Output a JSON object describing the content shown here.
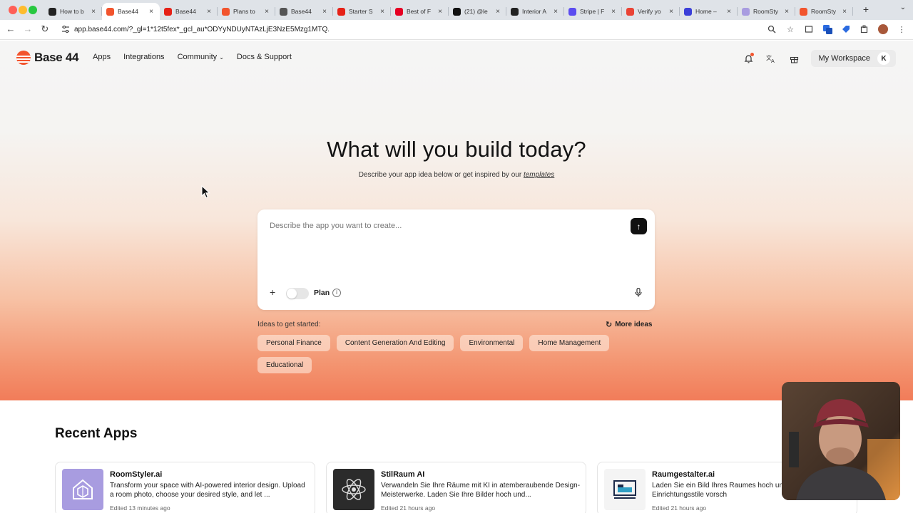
{
  "browser": {
    "tabs": [
      {
        "title": "How to b",
        "color": "#222222",
        "active": false
      },
      {
        "title": "Base44",
        "color": "#f2542d",
        "active": true
      },
      {
        "title": "Base44",
        "color": "#e62117",
        "active": false
      },
      {
        "title": "Plans to",
        "color": "#f2542d",
        "active": false
      },
      {
        "title": "Base44",
        "color": "#555555",
        "active": false
      },
      {
        "title": "Starter S",
        "color": "#e62117",
        "active": false
      },
      {
        "title": "Best of F",
        "color": "#e60023",
        "active": false
      },
      {
        "title": "(21) @le",
        "color": "#111111",
        "active": false
      },
      {
        "title": "Interior A",
        "color": "#222222",
        "active": false
      },
      {
        "title": "Stripe | F",
        "color": "#5b4cf0",
        "active": false
      },
      {
        "title": "Verify yo",
        "color": "#ea4335",
        "active": false
      },
      {
        "title": "Home –",
        "color": "#3b3fd8",
        "active": false
      },
      {
        "title": "RoomSty",
        "color": "#a89ce0",
        "active": false
      },
      {
        "title": "RoomSty",
        "color": "#f2542d",
        "active": false
      }
    ],
    "url": "app.base44.com/?_gl=1*12t5fex*_gcl_au*ODYyNDUyNTAzLjE3NzE5Mzg1MTQ."
  },
  "header": {
    "logo_text": "Base 44",
    "nav": [
      {
        "label": "Apps",
        "dropdown": false
      },
      {
        "label": "Integrations",
        "dropdown": false
      },
      {
        "label": "Community",
        "dropdown": true
      },
      {
        "label": "Docs & Support",
        "dropdown": false
      }
    ],
    "workspace_label": "My Workspace",
    "avatar_initial": "K"
  },
  "hero": {
    "title": "What will you build today?",
    "subtitle": "Describe your app idea below or get inspired by our",
    "templates_link": "templates"
  },
  "prompt": {
    "placeholder": "Describe the app you want to create...",
    "plan_label": "Plan",
    "plan_enabled": false
  },
  "ideas": {
    "label": "Ideas to get started:",
    "more_label": "More ideas",
    "chips": [
      "Personal Finance",
      "Content Generation And Editing",
      "Environmental",
      "Home Management",
      "Educational"
    ]
  },
  "recent": {
    "title": "Recent Apps",
    "apps": [
      {
        "name": "RoomStyler.ai",
        "description": "Transform your space with AI-powered interior design. Upload a room photo, choose your desired style, and let ...",
        "edited": "Edited 13 minutes ago"
      },
      {
        "name": "StilRaum AI",
        "description": "Verwandeln Sie Ihre Räume mit KI in atemberaubende Design-Meisterwerke. Laden Sie Ihre Bilder hoch und...",
        "edited": "Edited 21 hours ago"
      },
      {
        "name": "Raumgestalter.ai",
        "description": "Laden Sie ein Bild Ihres Raumes hoch und verschiedene Einrichtungsstile vorsch",
        "edited": "Edited 21 hours ago"
      }
    ]
  },
  "colors": {
    "brand": "#f2542d"
  }
}
